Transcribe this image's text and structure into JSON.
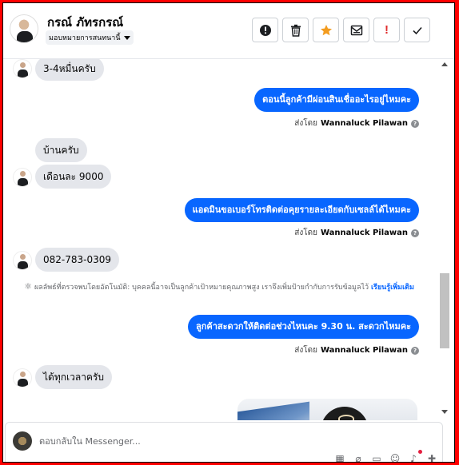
{
  "header": {
    "contact_name": "กรณ์ ภัทรกรณ์",
    "assignment_label": "มอบหมายการสนทนานี้",
    "tools": [
      {
        "icon": "alert-circle-icon",
        "glyph": "!"
      },
      {
        "icon": "trash-icon",
        "glyph": "🗑"
      },
      {
        "icon": "star-icon",
        "glyph": "★"
      },
      {
        "icon": "mail-icon",
        "glyph": "✉"
      },
      {
        "icon": "exclamation-icon",
        "glyph": "!"
      },
      {
        "icon": "check-icon",
        "glyph": "✓"
      }
    ]
  },
  "messages": [
    {
      "dir": "in",
      "text": "3-4หมื่นครับ"
    },
    {
      "dir": "out",
      "text": "ตอนนี้ลูกค้ามีผ่อนสินเชื่ออะไรอยู่ไหมคะ",
      "sent_by_label": "ส่งโดย",
      "sender": "Wannaluck Pilawan"
    },
    {
      "dir": "in",
      "text": "บ้านครับ"
    },
    {
      "dir": "in",
      "text": "เดือนละ 9000"
    },
    {
      "dir": "out",
      "text": "แอดมินขอเบอร์โทรติดต่อคุยรายละเอียดกับเซลล์ได้ไหมคะ",
      "sent_by_label": "ส่งโดย",
      "sender": "Wannaluck Pilawan"
    },
    {
      "dir": "in",
      "text": "082-783-0309"
    },
    {
      "dir": "out",
      "text": "ลูกค้าสะดวกให้ติดต่อช่วงไหนคะ  9.30 น.  สะดวกไหมคะ",
      "sent_by_label": "ส่งโดย",
      "sender": "Wannaluck Pilawan"
    },
    {
      "dir": "in",
      "text": "ได้ทุกเวลาครับ"
    }
  ],
  "notice": {
    "label": "ผลลัพธ์ที่ตรวจพบโดยอัตโนมัติ:",
    "text": "บุคคลนี้อาจเป็นลูกค้าเป้าหมายคุณภาพสูง เราจึงเพิ่มป้ายกำกับการรับข้อมูลไว้",
    "link": "เรียนรู้เพิ่มเติม"
  },
  "composer": {
    "placeholder": "ตอบกลับใน Messenger..."
  },
  "colors": {
    "accent": "#0866ff",
    "incoming_bubble": "#e4e6eb",
    "star": "#f39c1f",
    "alert_red": "#e02d2d"
  }
}
